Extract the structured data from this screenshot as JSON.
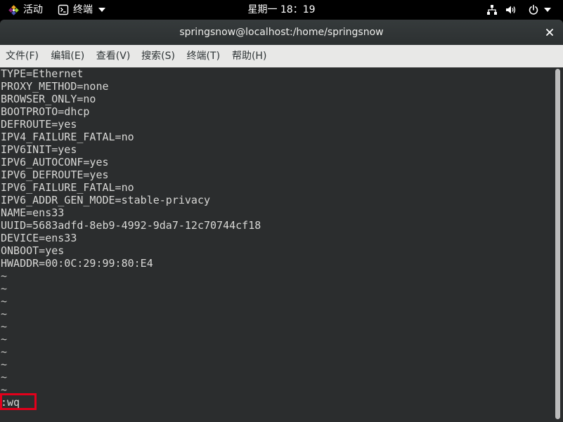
{
  "topbar": {
    "activities_label": "活动",
    "app_menu_label": "终端",
    "clock": "星期一 18：19",
    "icons": [
      "centos-logo-icon",
      "terminal-icon",
      "caret-down-icon",
      "network-wired-icon",
      "volume-icon",
      "power-icon",
      "caret-down-icon"
    ]
  },
  "window": {
    "title": "springsnow@localhost:/home/springsnow",
    "icons": [
      "close-icon"
    ]
  },
  "menubar": {
    "items": [
      {
        "label": "文件(F)"
      },
      {
        "label": "编辑(E)"
      },
      {
        "label": "查看(V)"
      },
      {
        "label": "搜索(S)"
      },
      {
        "label": "终端(T)"
      },
      {
        "label": "帮助(H)"
      }
    ]
  },
  "terminal": {
    "file_lines": [
      "TYPE=Ethernet",
      "PROXY_METHOD=none",
      "BROWSER_ONLY=no",
      "BOOTPROTO=dhcp",
      "DEFROUTE=yes",
      "IPV4_FAILURE_FATAL=no",
      "IPV6INIT=yes",
      "IPV6_AUTOCONF=yes",
      "IPV6_DEFROUTE=yes",
      "IPV6_FAILURE_FATAL=no",
      "IPV6_ADDR_GEN_MODE=stable-privacy",
      "NAME=ens33",
      "UUID=5683adfd-8eb9-4992-9da7-12c70744cf18",
      "DEVICE=ens33",
      "ONBOOT=yes",
      "HWADDR=00:0C:29:99:80:E4"
    ],
    "empty_line_markers": [
      "~",
      "~",
      "~",
      "~",
      "~",
      "~",
      "~",
      "~",
      "~",
      "~"
    ],
    "command_line": ":wq"
  },
  "colors": {
    "top_bar": "#000000",
    "title_bar": "#2f3334",
    "menu_bar": "#e8e8e7",
    "terminal_background": "#2b2d2e",
    "terminal_text": "#d8d8d6",
    "highlight_box": "#e3001b"
  }
}
